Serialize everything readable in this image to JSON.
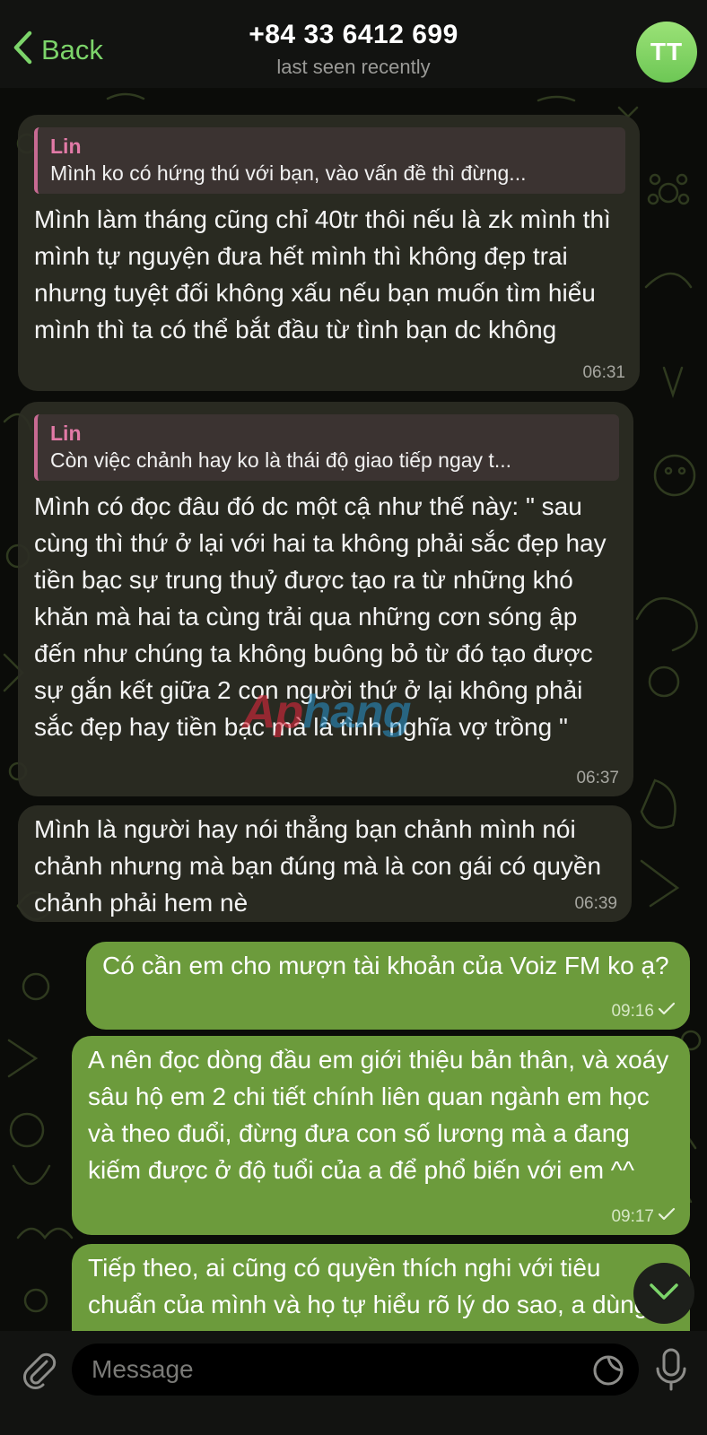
{
  "header": {
    "back_label": "Back",
    "title": "+84 33 6412 699",
    "subtitle": "last seen recently",
    "avatar_initials": "TT"
  },
  "messages": [
    {
      "direction": "incoming",
      "reply_name": "Lin",
      "reply_text": "Mình ko có hứng thú với bạn, vào vấn đề thì đừng...",
      "text": "Mình làm tháng cũng chỉ 40tr thôi nếu là zk mình thì mình tự nguyện đưa hết mình thì không đẹp trai nhưng tuyệt đối không xấu nếu bạn muốn tìm hiểu mình thì ta có thể bắt đầu từ tình bạn dc không",
      "time": "06:31"
    },
    {
      "direction": "incoming",
      "reply_name": "Lin",
      "reply_text": "Còn việc chảnh hay ko là thái độ giao tiếp ngay t...",
      "text": "Mình có đọc đâu đó dc một cậ như thế này: \" sau cùng thì thứ ở lại với hai ta không phải sắc đẹp hay tiền bạc sự trung thuỷ được tạo ra từ những khó khăn mà hai ta cùng trải qua những cơn sóng ập đến như chúng ta không buông bỏ từ đó tạo được sự gắn kết giữa 2 con người thứ ở lại không phải sắc đẹp hay tiền bạc mà là tình nghĩa vợ trồng \"",
      "time": "06:37"
    },
    {
      "direction": "incoming",
      "text": "Mình là người hay nói thẳng bạn chảnh mình nói chảnh nhưng mà bạn đúng mà là con gái có quyền chảnh phải hem nè",
      "time": "06:39"
    },
    {
      "direction": "outgoing",
      "text": "Có cần em cho mượn tài khoản của Voiz FM ko ạ?",
      "time": "09:16"
    },
    {
      "direction": "outgoing",
      "text": "A nên đọc dòng đầu em giới thiệu bản thân, và xoáy sâu hộ em 2 chi tiết chính liên quan ngành em học và theo đuổi, đừng đưa con số lương mà a đang kiếm được ở độ tuổi của a để phổ biến với em ^^",
      "time": "09:17"
    },
    {
      "direction": "outgoing",
      "text": "Tiếp theo, ai cũng có quyền thích nghi với tiêu chuẩn của mình và họ tự hiểu rõ lý do sao, a dùng từ 'chảnh' ở đây, mà còn dành"
    }
  ],
  "watermark": {
    "part1": "Ap",
    "part2": "hang"
  },
  "composer": {
    "placeholder": "Message"
  },
  "colors": {
    "accent": "#7cd46a",
    "outgoing_bubble": "#6c9b3c",
    "reply_bar": "#c76a92"
  },
  "icons": [
    "chevron-left-icon",
    "paperclip-icon",
    "sticker-icon",
    "microphone-icon",
    "chevron-down-icon",
    "checkmark-icon"
  ]
}
